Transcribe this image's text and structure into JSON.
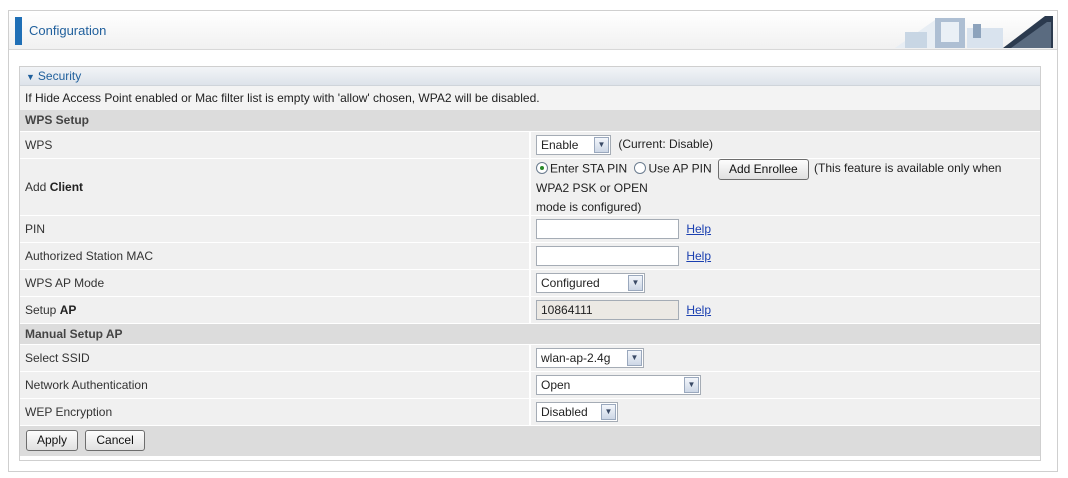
{
  "header": {
    "title": "Configuration"
  },
  "security": {
    "title": "Security",
    "note": "If Hide Access Point enabled or Mac filter list is empty with 'allow' chosen, WPA2 will be disabled.",
    "wps_setup": {
      "section_label": "WPS Setup",
      "wps": {
        "label": "WPS",
        "value": "Enable",
        "status": "(Current: Disable)"
      },
      "add_client": {
        "label_prefix": "Add ",
        "label_bold": "Client",
        "radio1": "Enter STA PIN",
        "radio2": "Use AP PIN",
        "button": "Add Enrollee",
        "note_line1": "(This feature is available only when WPA2 PSK or OPEN",
        "note_line2": "mode is configured)"
      },
      "pin": {
        "label": "PIN",
        "value": "",
        "help": "Help"
      },
      "authorized_mac": {
        "label": "Authorized Station MAC",
        "value": "",
        "help": "Help"
      },
      "ap_mode": {
        "label": "WPS AP Mode",
        "value": "Configured"
      },
      "setup_ap": {
        "label_prefix": "Setup ",
        "label_bold": "AP",
        "value": "10864111",
        "help": "Help"
      }
    },
    "manual_setup": {
      "section_label": "Manual Setup AP",
      "select_ssid": {
        "label": "Select SSID",
        "value": "wlan-ap-2.4g"
      },
      "network_auth": {
        "label": "Network Authentication",
        "value": "Open"
      },
      "wep": {
        "label": "WEP Encryption",
        "value": "Disabled"
      }
    },
    "buttons": {
      "apply": "Apply",
      "cancel": "Cancel"
    }
  },
  "colors": {
    "accent": "#1f6fb6",
    "link": "#1a3fb0",
    "section_bg": "#dcdcdc"
  },
  "icons": {
    "collapse": "triangle-down-icon",
    "dropdown": "chevron-down-icon",
    "radio_selected": "radio-selected",
    "radio_unselected": "radio-unselected"
  }
}
